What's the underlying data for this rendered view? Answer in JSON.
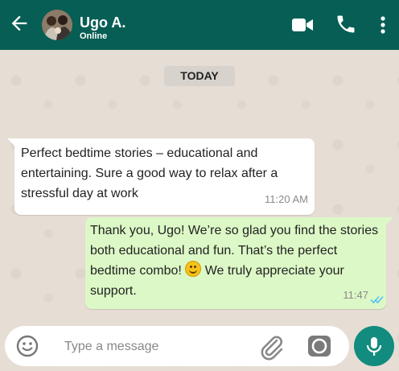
{
  "header": {
    "contact_name": "Ugo A.",
    "status": "Online"
  },
  "date_chip": "TODAY",
  "messages": [
    {
      "direction": "incoming",
      "text": "Perfect bedtime stories – educational and entertaining. Sure a good way to relax after a stressful day at work",
      "time": "11:20 AM"
    },
    {
      "direction": "outgoing",
      "text_before_emoji": "Thank you, Ugo! We’re so glad you find the stories both educational and fun. That’s the perfect bedtime combo! ",
      "emoji": "smiling-face-icon",
      "text_after_emoji": " We truly appreciate your support.",
      "time": "11:47",
      "status": "read"
    }
  ],
  "composer": {
    "placeholder": "Type a message"
  },
  "icons": {
    "back": "arrow-left-icon",
    "video": "video-camera-icon",
    "call": "phone-icon",
    "menu": "more-vertical-icon",
    "emoji": "smiley-icon",
    "attach": "paperclip-icon",
    "camera": "camera-icon",
    "mic": "microphone-icon"
  },
  "colors": {
    "header": "#075e54",
    "outgoing_bubble": "#dcf8c6",
    "incoming_bubble": "#ffffff",
    "mic_button": "#128c7e",
    "read_ticks": "#4fc3f7"
  }
}
